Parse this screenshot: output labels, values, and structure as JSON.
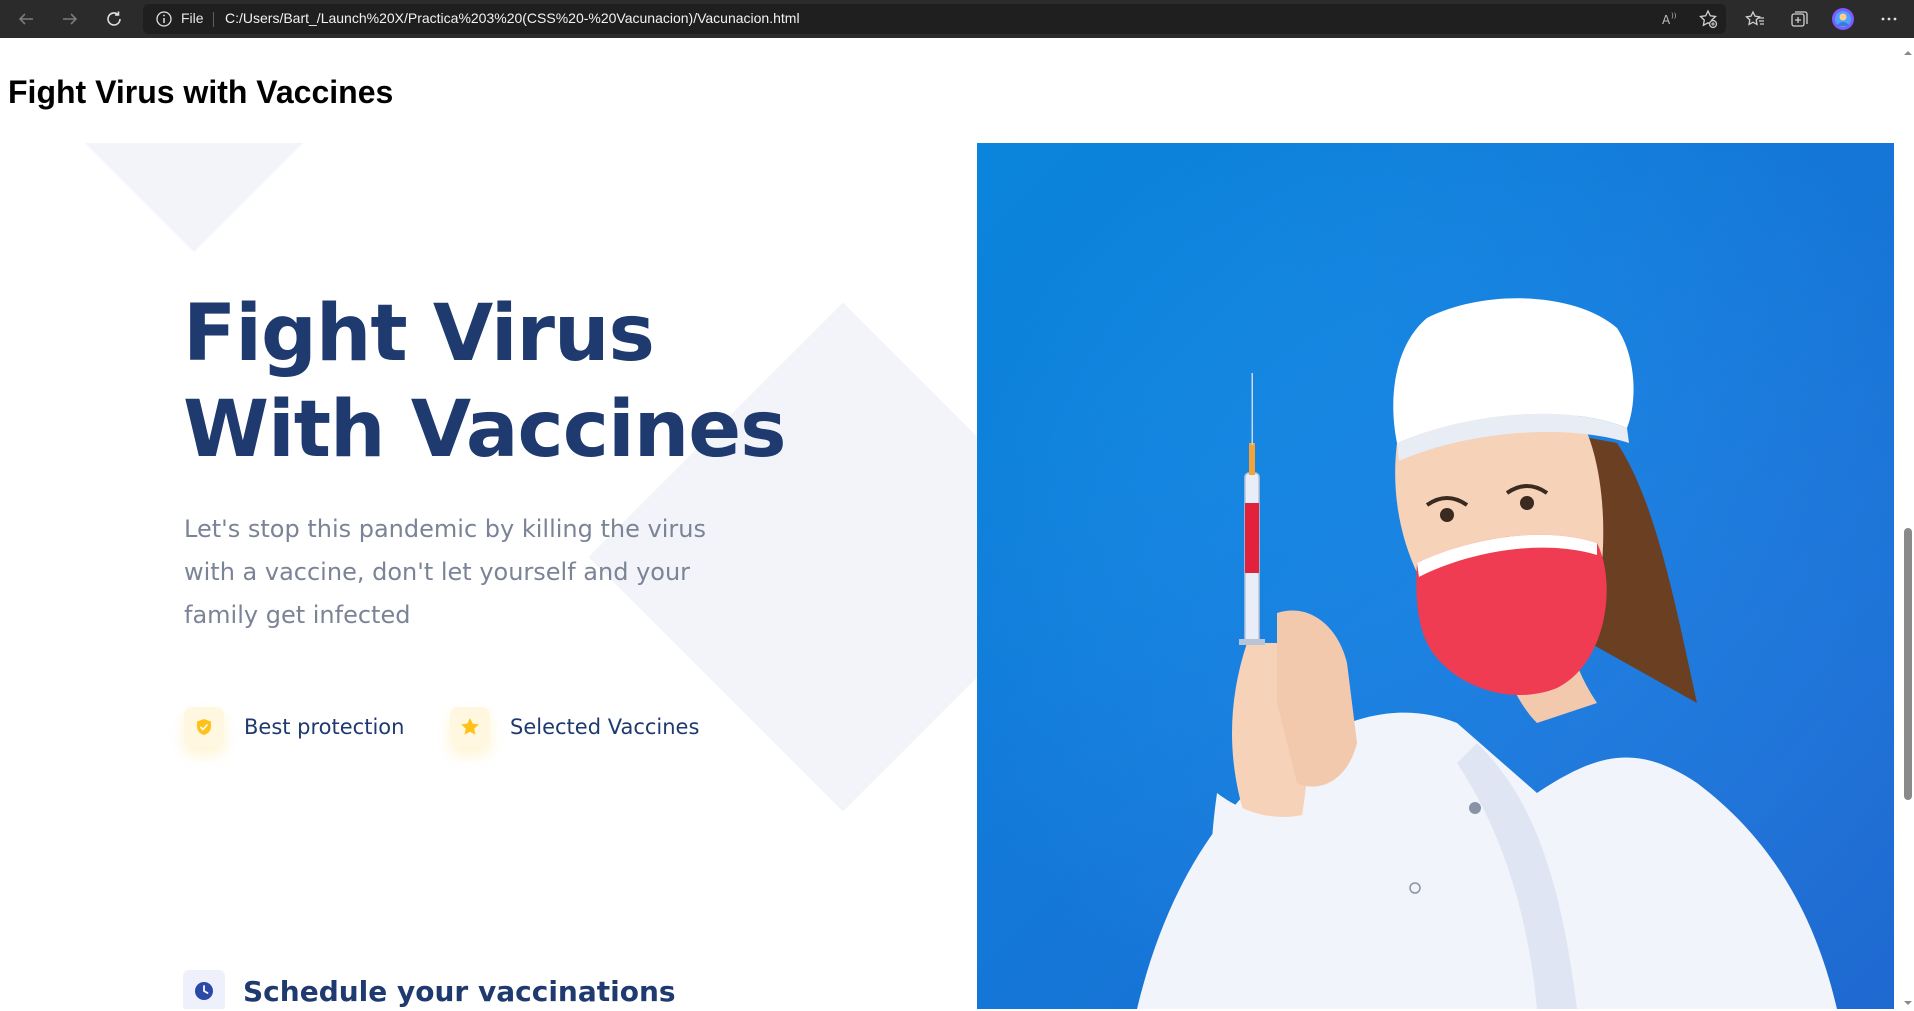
{
  "browser": {
    "address_prefix": "File",
    "url": "C:/Users/Bart_/Launch%20X/Practica%203%20(CSS%20-%20Vacunacion)/Vacunacion.html",
    "icons": [
      "back-icon",
      "forward-icon",
      "refresh-icon",
      "info-icon",
      "read-aloud-icon",
      "add-favorite-icon",
      "favorites-icon",
      "collections-icon",
      "profile-icon",
      "more-icon"
    ]
  },
  "page": {
    "heading": "Fight Virus with Vaccines"
  },
  "hero": {
    "title_line1": "Fight Virus",
    "title_line2": "With Vaccines",
    "subtitle_line1": "Let's stop this pandemic by killing the virus",
    "subtitle_line2": "with a vaccine, don't let yourself and your",
    "subtitle_line3": "family get infected",
    "features": [
      {
        "label": "Best protection",
        "icon": "shield-check-icon"
      },
      {
        "label": "Selected Vaccines",
        "icon": "star-icon"
      }
    ],
    "schedule_label": "Schedule your vaccinations",
    "schedule_icon": "clock-icon"
  },
  "colors": {
    "title": "#1e3a6e",
    "subtitle": "#7b8496",
    "accent_yellow": "#ffc21a",
    "hero_blue": "#1787e3"
  }
}
